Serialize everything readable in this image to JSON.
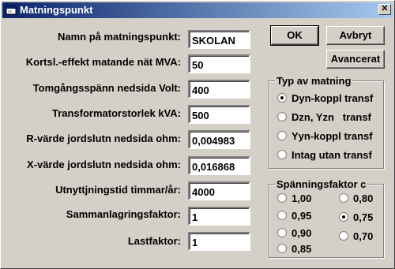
{
  "window": {
    "title": "Matningspunkt"
  },
  "fields": [
    {
      "label": "Namn på matningspunkt:",
      "value": "SKOLAN"
    },
    {
      "label": "Kortsl.-effekt matande nät MVA:",
      "value": "50"
    },
    {
      "label": "Tomgångsspänn nedsida Volt:",
      "value": "400"
    },
    {
      "label": "Transformatorstorlek kVA:",
      "value": "500"
    },
    {
      "label": "R-värde jordslutn nedsida ohm:",
      "value": "0,004983"
    },
    {
      "label": "X-värde jordslutn nedsida ohm:",
      "value": "0,016868"
    },
    {
      "label": "Utnyttjningstid timmar/år:",
      "value": "4000"
    },
    {
      "label": "Sammanlagringsfaktor:",
      "value": "1"
    },
    {
      "label": "Lastfaktor:",
      "value": "1"
    }
  ],
  "buttons": {
    "ok": "OK",
    "cancel": "Avbryt",
    "advanced": "Avancerat"
  },
  "feed_type": {
    "title": "Typ av matning",
    "options": [
      "Dyn-koppl transf",
      "Dzn, Yzn   transf",
      "Yyn-koppl transf",
      "Intag utan transf"
    ],
    "selected": 0
  },
  "voltage_factor": {
    "title": "Spänningsfaktor c",
    "left_options": [
      "1,00",
      "0,95",
      "0,90",
      "0,85"
    ],
    "right_options": [
      "0,80",
      "0,75",
      "0,70"
    ],
    "selected": "0,75"
  }
}
